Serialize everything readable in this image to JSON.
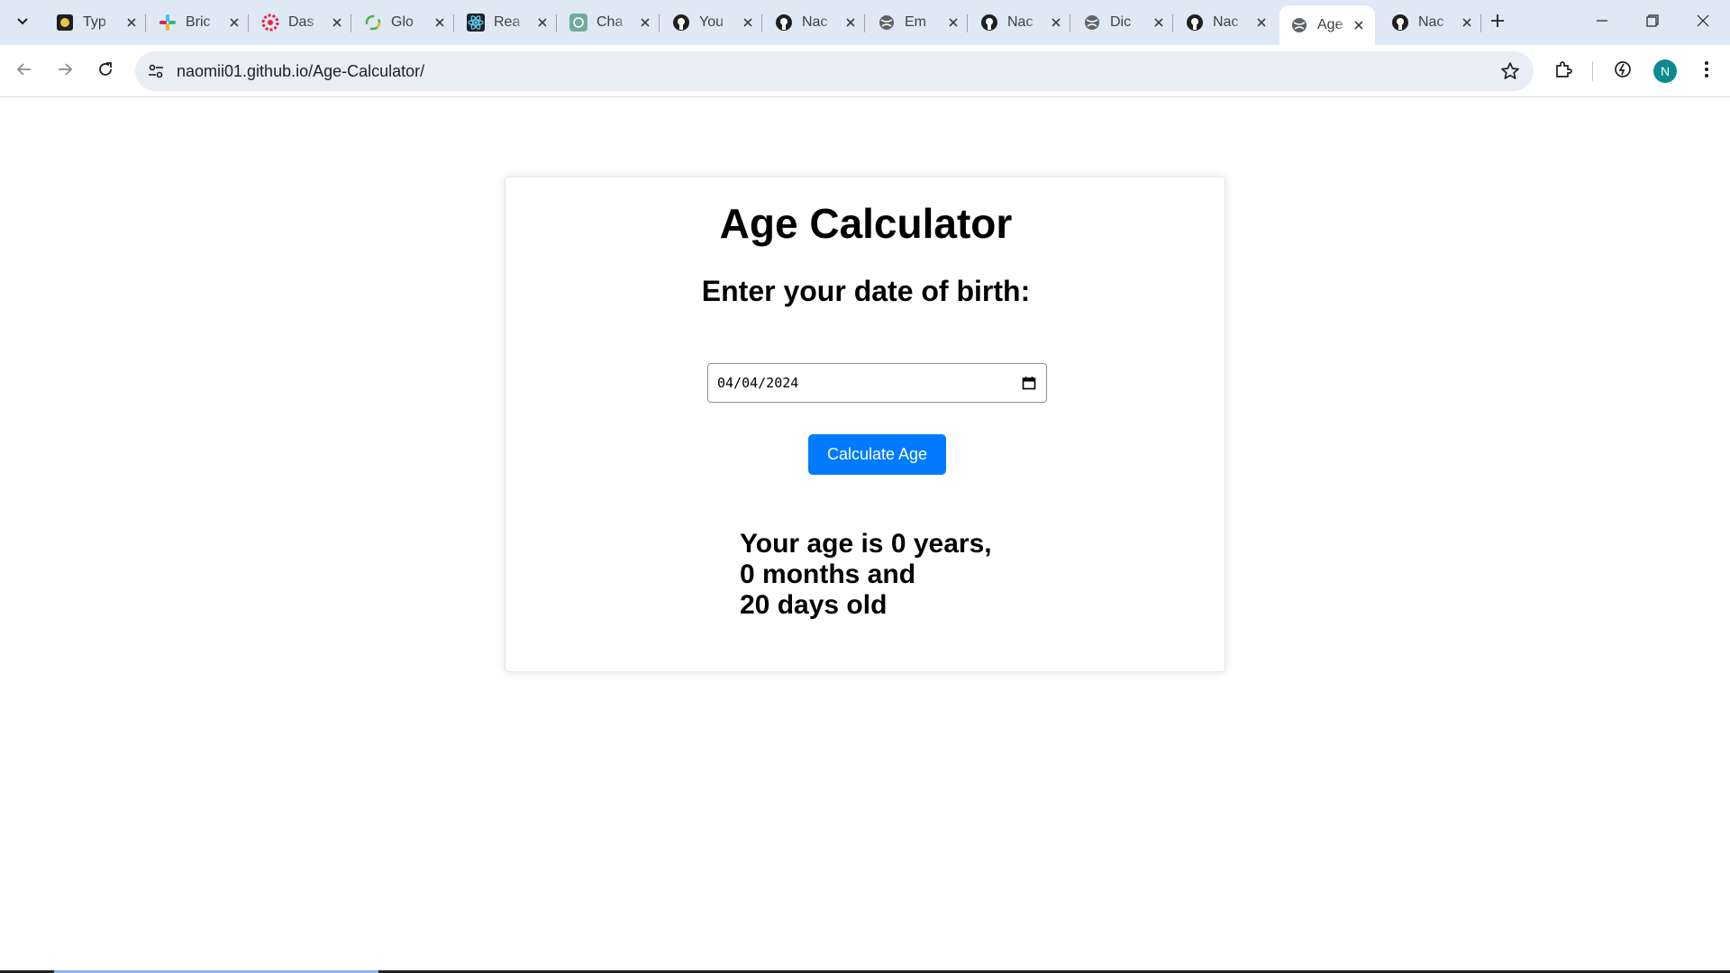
{
  "browser": {
    "tabs": [
      {
        "title": "Typ",
        "icon": "typing-site-icon",
        "active": false
      },
      {
        "title": "Bric",
        "icon": "slack-icon",
        "active": false
      },
      {
        "title": "Das",
        "icon": "dashboard-icon",
        "active": false
      },
      {
        "title": "Glo",
        "icon": "globe-loader-icon",
        "active": false
      },
      {
        "title": "Rea",
        "icon": "react-icon",
        "active": false
      },
      {
        "title": "Cha",
        "icon": "chatgpt-icon",
        "active": false
      },
      {
        "title": "You",
        "icon": "github-icon",
        "active": false
      },
      {
        "title": "Nac",
        "icon": "github-icon",
        "active": false
      },
      {
        "title": "Em",
        "icon": "globe-icon",
        "active": false
      },
      {
        "title": "Nac",
        "icon": "github-icon",
        "active": false
      },
      {
        "title": "Dic",
        "icon": "globe-icon",
        "active": false
      },
      {
        "title": "Nac",
        "icon": "github-icon",
        "active": false
      },
      {
        "title": "Age",
        "icon": "globe-icon",
        "active": true
      },
      {
        "title": "Nac",
        "icon": "github-icon",
        "active": false
      }
    ],
    "url": "naomii01.github.io/Age-Calculator/",
    "profile_initial": "N",
    "colors": {
      "tabstrip": "#dfe8f5",
      "avatar": "#0b8a8f"
    }
  },
  "app": {
    "title": "Age Calculator",
    "prompt": "Enter your date of birth:",
    "date_value": "04/04/2024",
    "button_label": "Calculate Age",
    "result_lines": [
      "Your age is 0 years,",
      "0 months and",
      "20 days old"
    ],
    "colors": {
      "button": "#007bff"
    }
  }
}
